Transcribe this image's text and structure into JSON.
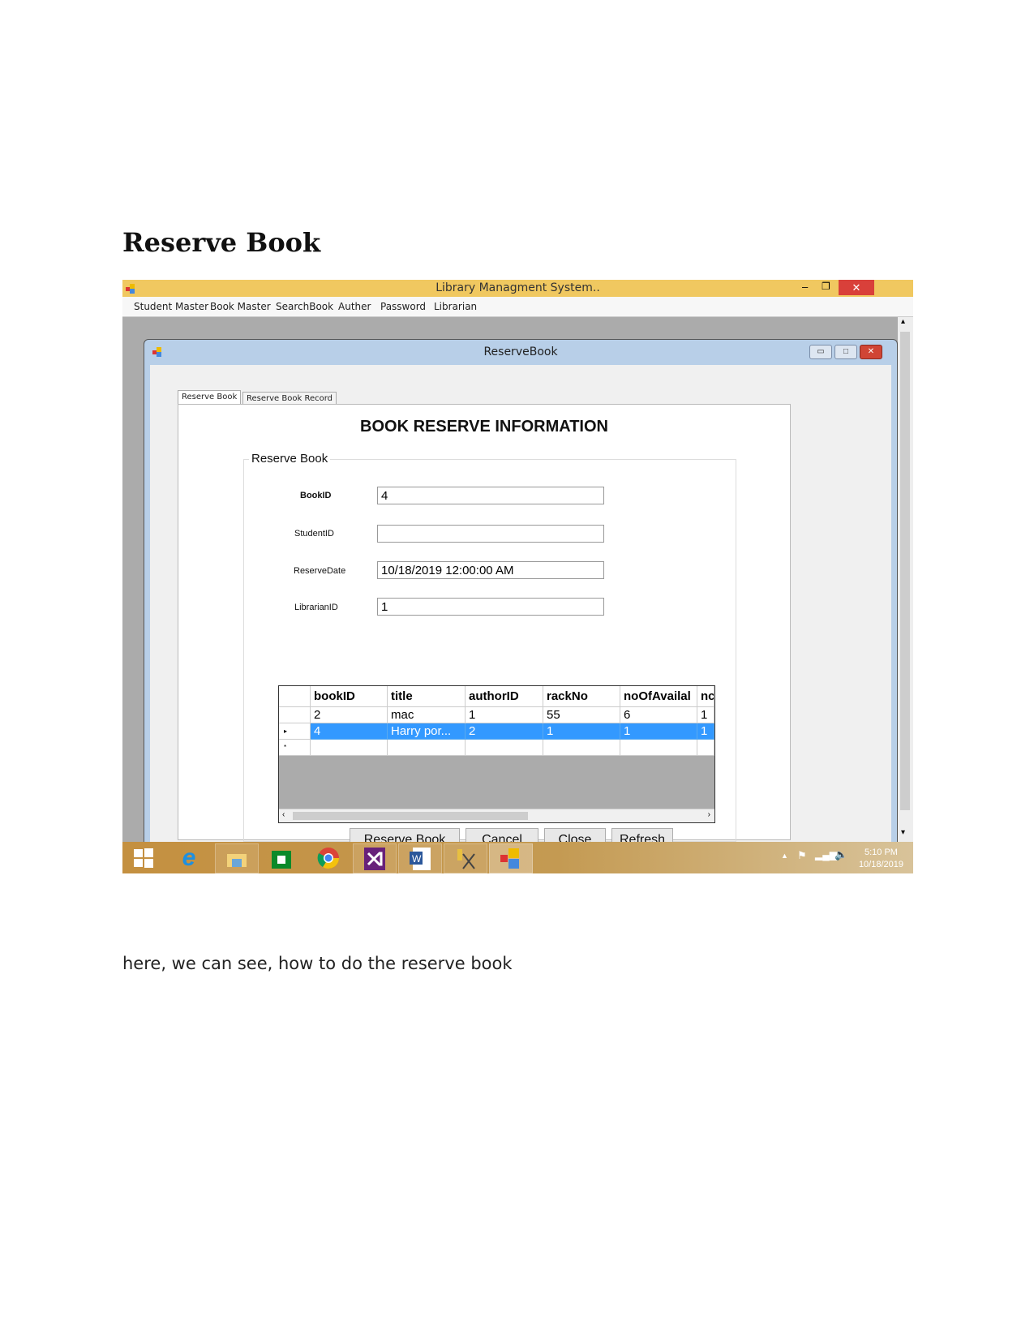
{
  "document": {
    "title": "Reserve Book",
    "caption": "here, we can see, how to do the reserve book"
  },
  "app": {
    "title": "Library Managment System..",
    "menu": [
      "Student Master",
      "Book Master",
      "SearchBook",
      "Auther",
      "Password",
      "Librarian"
    ]
  },
  "child": {
    "title": "ReserveBook",
    "tabs": [
      "Reserve Book",
      "Reserve Book Record"
    ],
    "heading": "BOOK RESERVE INFORMATION",
    "group_label": "Reserve Book",
    "fields": [
      {
        "label": "BookID",
        "value": "4"
      },
      {
        "label": "StudentID",
        "value": ""
      },
      {
        "label": "ReserveDate",
        "value": "10/18/2019 12:00:00 AM"
      },
      {
        "label": "LibrarianID",
        "value": "1"
      }
    ],
    "grid": {
      "columns": [
        "bookID",
        "title",
        "authorID",
        "rackNo",
        "noOfAvailal",
        "nc"
      ],
      "rows": [
        [
          "2",
          "mac",
          "1",
          "55",
          "6",
          "1"
        ],
        [
          "4",
          "Harry por...",
          "2",
          "1",
          "1",
          "1"
        ]
      ],
      "selected_row": 1
    },
    "buttons": [
      "Reserve Book",
      "Cancel",
      "Close",
      "Refresh"
    ]
  },
  "taskbar": {
    "icons": [
      "windows-start",
      "internet-explorer",
      "file-explorer",
      "store",
      "chrome",
      "visual-studio",
      "word",
      "tools",
      "app"
    ],
    "time": "5:10 PM",
    "date": "10/18/2019"
  },
  "colors": {
    "titlebar": "#f0c860",
    "selection": "#3399ff",
    "taskbar": "#c49040"
  }
}
